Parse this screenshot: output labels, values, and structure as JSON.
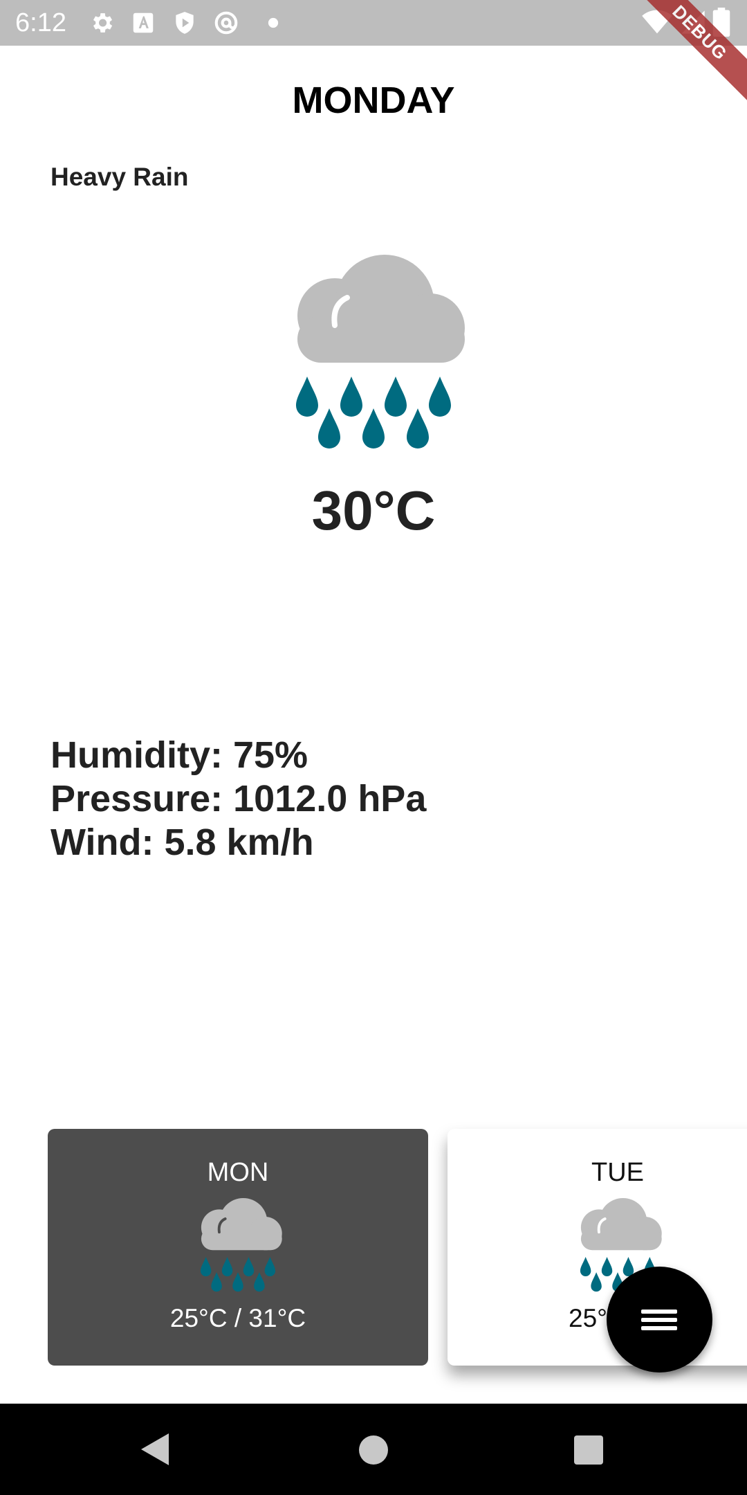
{
  "status_bar": {
    "time": "6:12",
    "icons": [
      "settings-icon",
      "font-download-icon",
      "shield-play-icon",
      "at-sign-icon",
      "dot-icon",
      "wifi-icon",
      "signal-icon",
      "battery-icon"
    ]
  },
  "debug_ribbon": {
    "label": "DEBUG"
  },
  "weather": {
    "day": "MONDAY",
    "condition": "Heavy Rain",
    "temperature": "30°C",
    "icon": "heavy-rain-icon",
    "humidity": "Humidity: 75%",
    "pressure": "Pressure: 1012.0 hPa",
    "wind": "Wind: 5.8 km/h"
  },
  "forecast": [
    {
      "day": "MON",
      "icon": "heavy-rain-icon",
      "range": "25°C / 31°C",
      "selected": true
    },
    {
      "day": "TUE",
      "icon": "heavy-rain-icon",
      "range": "25°",
      "selected": false
    }
  ],
  "fab": {
    "icon": "menu-icon"
  },
  "nav_bar": {
    "icons": [
      "back-icon",
      "home-icon",
      "recents-icon"
    ]
  },
  "colors": {
    "status_bar": "#bdbdbd",
    "cloud": "#bdbdbd",
    "rain_drop": "#006b80",
    "selected_card": "#4d4d4d",
    "fab": "#000000",
    "debug_ribbon": "#a52a2a"
  }
}
